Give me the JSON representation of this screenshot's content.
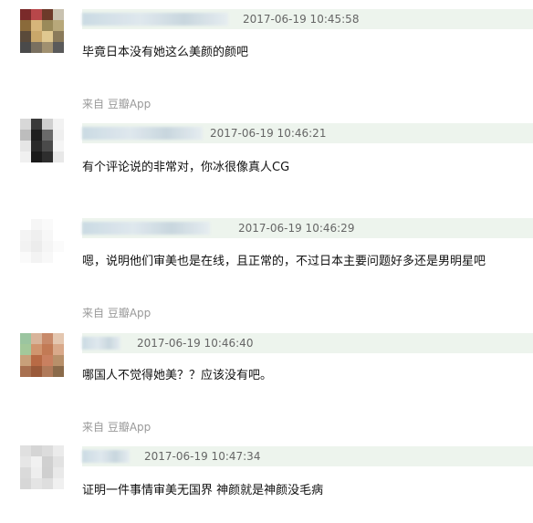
{
  "source_label": "来自 豆瓣App",
  "comments": [
    {
      "timestamp": "2017-06-19 10:45:58",
      "text": "毕竟日本没有她这么美颜的颜吧"
    },
    {
      "timestamp": "2017-06-19 10:46:21",
      "text": "有个评论说的非常对，你冰很像真人CG"
    },
    {
      "timestamp": "2017-06-19 10:46:29",
      "text": "嗯，说明他们审美也是在线，且正常的，不过日本主要问题好多还是男明星吧"
    },
    {
      "timestamp": "2017-06-19 10:46:40",
      "text": "哪国人不觉得她美？？应该没有吧。"
    },
    {
      "timestamp": "2017-06-19 10:47:34",
      "text": "证明一件事情审美无国界 神颜就是神颜没毛病"
    }
  ],
  "colors": {
    "meta_bar": "#edf4ed",
    "timestamp": "#666666",
    "source": "#999999",
    "text": "#111111"
  }
}
